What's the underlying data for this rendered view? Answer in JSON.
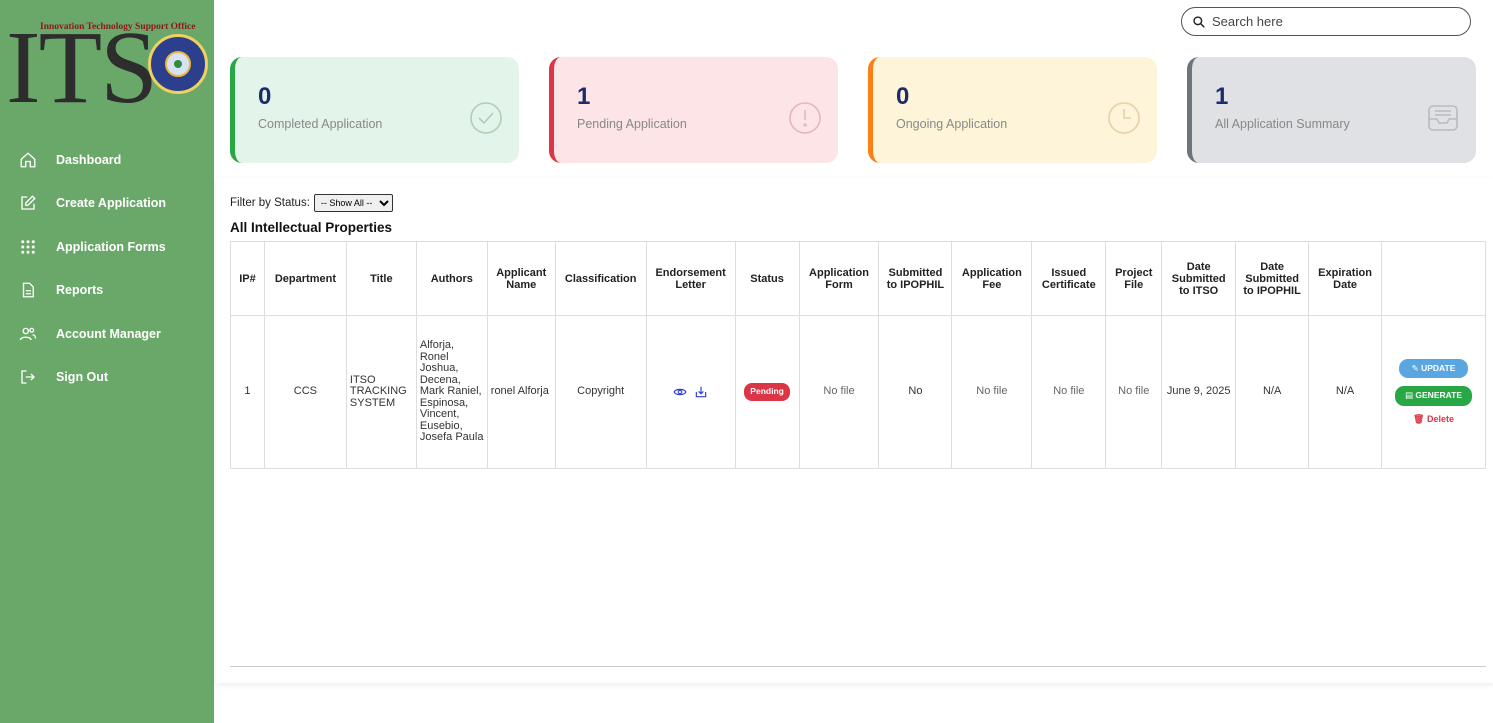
{
  "sidebar": {
    "logo_text": "ITS",
    "logo_tagline": "Innovation Technology Support Office",
    "items": [
      {
        "label": "Dashboard",
        "icon": "home-icon"
      },
      {
        "label": "Create Application",
        "icon": "edit-icon"
      },
      {
        "label": "Application Forms",
        "icon": "grid-icon"
      },
      {
        "label": "Reports",
        "icon": "file-icon"
      },
      {
        "label": "Account Manager",
        "icon": "users-icon"
      },
      {
        "label": "Sign Out",
        "icon": "sign-out-icon"
      }
    ]
  },
  "search": {
    "placeholder": "Search here"
  },
  "cards": [
    {
      "count": "0",
      "label": "Completed Application",
      "icon": "check-circle-icon",
      "accent": "#28a745"
    },
    {
      "count": "1",
      "label": "Pending Application",
      "icon": "alert-circle-icon",
      "accent": "#dc3545"
    },
    {
      "count": "0",
      "label": "Ongoing Application",
      "icon": "clock-icon",
      "accent": "#fd7e14"
    },
    {
      "count": "1",
      "label": "All Application Summary",
      "icon": "inbox-icon",
      "accent": "#6c757d"
    }
  ],
  "filter": {
    "label": "Filter by Status:",
    "selected": "-- Show All --"
  },
  "table": {
    "title": "All Intellectual Properties",
    "headers": [
      "IP#",
      "Department",
      "Title",
      "Authors",
      "Applicant Name",
      "Classification",
      "Endorsement Letter",
      "Status",
      "Application Form",
      "Submitted to IPOPHIL",
      "Application Fee",
      "Issued Certificate",
      "Project File",
      "Date Submitted to ITSO",
      "Date Submitted to IPOPHIL",
      "Expiration Date",
      ""
    ],
    "rows": [
      {
        "ip": "1",
        "department": "CCS",
        "title": "ITSO TRACKING SYSTEM",
        "authors": "Alforja, Ronel Joshua, Decena, Mark Raniel, Espinosa, Vincent, Eusebio, Josefa Paula",
        "applicant": "ronel Alforja",
        "classification": "Copyright",
        "status": "Pending",
        "application_form": "No file",
        "submitted_ipophil": "No",
        "application_fee": "No file",
        "issued_certificate": "No file",
        "project_file": "No file",
        "date_itso": "June 9, 2025",
        "date_ipophil": "N/A",
        "expiration": "N/A",
        "actions": {
          "update": "UPDATE",
          "generate": "GENERATE",
          "delete": "Delete"
        }
      }
    ]
  }
}
